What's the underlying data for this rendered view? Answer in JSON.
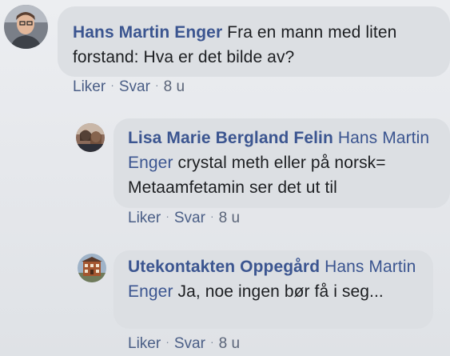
{
  "comments": [
    {
      "author": "Hans Martin Enger",
      "text": " Fra en mann med liten forstand: Hva er det bilde av?",
      "like_label": "Liker",
      "reply_label": "Svar",
      "timestamp": "8 u",
      "avatar_icon": "person-photo-avatar"
    },
    {
      "author": "Lisa Marie Bergland Felin",
      "mention": "Hans Martin Enger",
      "text": " crystal meth eller på norsk= Metaamfetamin ser det ut til",
      "like_label": "Liker",
      "reply_label": "Svar",
      "timestamp": "8 u",
      "avatar_icon": "person-photo-avatar"
    },
    {
      "author": "Utekontakten Oppegård",
      "mention": "Hans Martin Enger",
      "text": " Ja, noe ingen bør få i seg...",
      "like_label": "Liker",
      "reply_label": "Svar",
      "timestamp": "8 u",
      "avatar_icon": "building-photo-avatar"
    }
  ],
  "separator": "·",
  "colors": {
    "author_link": "#3b5590",
    "bubble_bg": "#dcdfe3",
    "action_link": "#4a5e86",
    "page_bg": "#e6e8ec"
  }
}
